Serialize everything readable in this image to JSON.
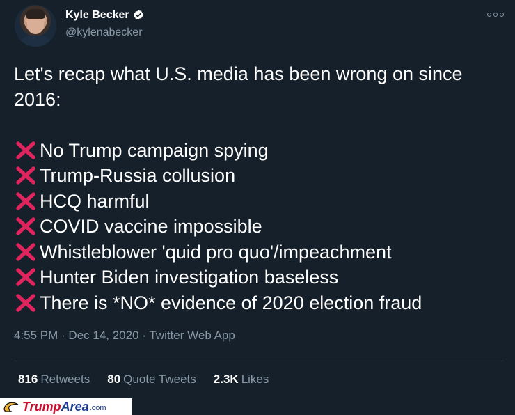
{
  "author": {
    "name": "Kyle Becker",
    "handle": "@kylenabecker",
    "verified_icon": "verified-badge-icon"
  },
  "tweet": {
    "intro": "Let's recap what U.S. media has been wrong on since 2016:",
    "items": [
      "No Trump campaign spying",
      "Trump-Russia collusion",
      "HCQ harmful",
      "COVID vaccine impossible",
      "Whistleblower 'quid pro quo'/impeachment",
      "Hunter Biden investigation baseless",
      "There is *NO* evidence of 2020 election fraud"
    ],
    "item_icon": "red-cross-mark-icon",
    "timestamp": "4:55 PM · Dec 14, 2020 · Twitter Web App"
  },
  "stats": {
    "retweets_count": "816",
    "retweets_label": "Retweets",
    "quotes_count": "80",
    "quotes_label": "Quote Tweets",
    "likes_count": "2.3K",
    "likes_label": "Likes"
  },
  "watermark": {
    "part1": "Trump",
    "part2": "Area",
    "part3": ".com"
  },
  "colors": {
    "background": "#15202b",
    "secondary_text": "#8899a6",
    "cross": "#e0245e",
    "verified": "#ffffff"
  }
}
